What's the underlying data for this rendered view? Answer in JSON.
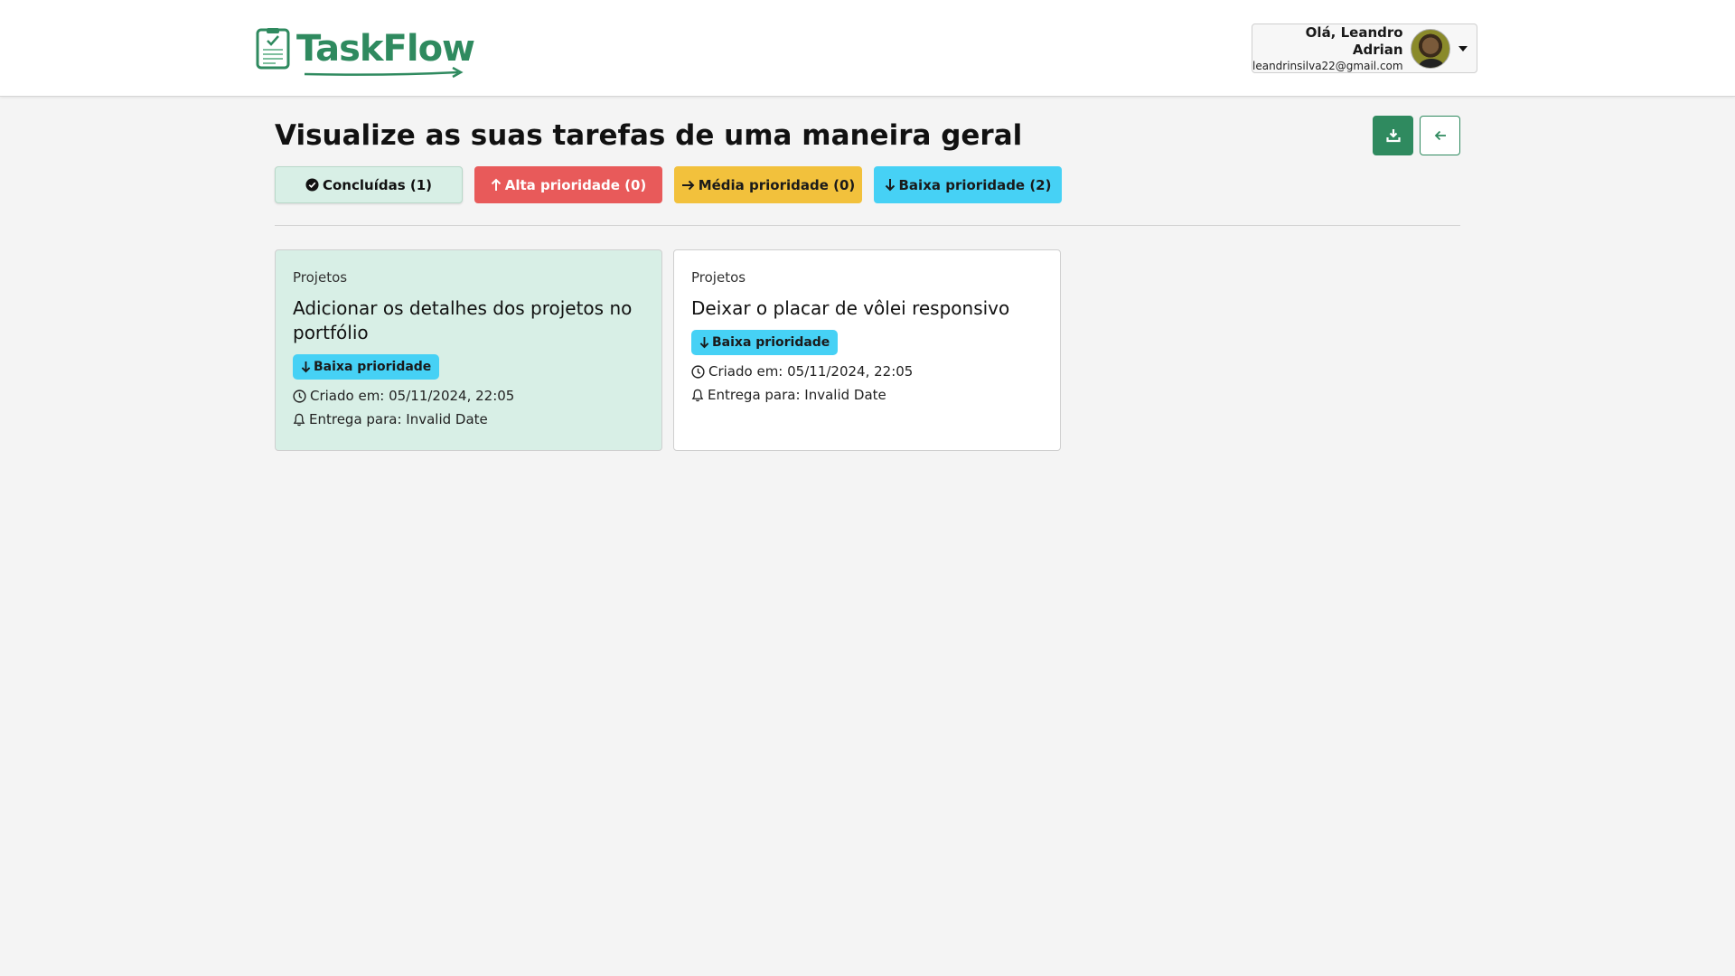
{
  "header": {
    "logo_text": "TaskFlow",
    "user": {
      "greeting": "Olá, Leandro Adrian",
      "email": "leandrinsilva22@gmail.com"
    }
  },
  "page": {
    "title": "Visualize as suas tarefas de uma maneira geral"
  },
  "filters": [
    {
      "label": "Concluídas (1)",
      "icon": "check-circle-icon",
      "color": "#d8efe6"
    },
    {
      "label": "Alta prioridade (0)",
      "icon": "arrow-up-icon",
      "color": "#e85a5a"
    },
    {
      "label": "Média prioridade (0)",
      "icon": "arrow-right-icon",
      "color": "#f2c13c"
    },
    {
      "label": "Baixa prioridade (2)",
      "icon": "arrow-down-icon",
      "color": "#46d1f5"
    }
  ],
  "tasks": [
    {
      "category": "Projetos",
      "title": "Adicionar os detalhes dos projetos no portfólio",
      "priority": "Baixa prioridade",
      "created": "Criado em: 05/11/2024, 22:05",
      "due": "Entrega para: Invalid Date",
      "completed": true
    },
    {
      "category": "Projetos",
      "title": "Deixar o placar de vôlei responsivo",
      "priority": "Baixa prioridade",
      "created": "Criado em: 05/11/2024, 22:05",
      "due": "Entrega para: Invalid Date",
      "completed": false
    }
  ],
  "colors": {
    "brand": "#2f8a5f",
    "completed_card": "#d8efe6",
    "high": "#e85a5a",
    "medium": "#f2c13c",
    "low": "#46d1f5"
  }
}
